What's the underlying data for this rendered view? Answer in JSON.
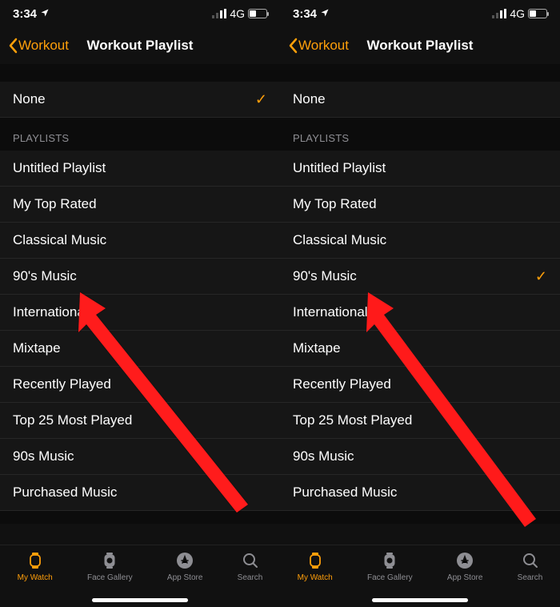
{
  "status": {
    "time": "3:34",
    "network": "4G"
  },
  "nav": {
    "back": "Workout",
    "title": "Workout Playlist"
  },
  "section_header": "PLAYLISTS",
  "none_label": "None",
  "playlists": [
    "Untitled Playlist",
    "My Top Rated",
    "Classical Music",
    "90's Music",
    "International",
    "Mixtape",
    "Recently Played",
    "Top 25 Most Played",
    "90s Music",
    "Purchased Music"
  ],
  "tabs": {
    "watch": "My Watch",
    "gallery": "Face Gallery",
    "store": "App Store",
    "search": "Search"
  },
  "screens": [
    {
      "selected": "none"
    },
    {
      "selected": "90's Music"
    }
  ],
  "accent": "#ff9f0a"
}
